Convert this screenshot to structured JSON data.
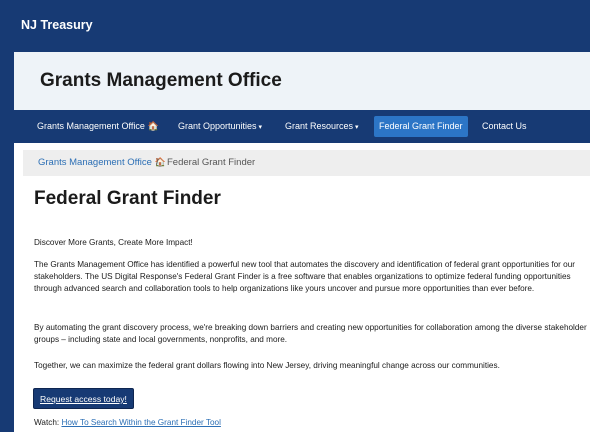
{
  "topbar": {
    "brand": "NJ Treasury"
  },
  "banner": {
    "title": "Grants Management Office"
  },
  "nav": {
    "items": [
      {
        "label": "Grants Management Office"
      },
      {
        "label": "Grant Opportunities",
        "caret": "▾"
      },
      {
        "label": "Grant Resources",
        "caret": "▾"
      },
      {
        "label": "Federal Grant Finder"
      },
      {
        "label": "Contact Us"
      }
    ],
    "home_glyph": "🏠",
    "active_color": "#2c75c6"
  },
  "breadcrumb": {
    "home": "Grants Management Office",
    "home_glyph": "🏠",
    "separator": "/",
    "current": "Federal Grant Finder"
  },
  "main": {
    "heading": "Federal Grant Finder",
    "p1": "Discover More Grants, Create More Impact!",
    "p2": "The Grants Management Office has identified a powerful new tool that automates the discovery and identification of federal grant opportunities for our stakeholders. The US Digital Response's Federal Grant Finder is a free software that enables organizations to optimize federal funding opportunities through advanced search and collaboration tools to help organizations like yours uncover and pursue more opportunities than ever before.",
    "p3": "By automating the grant discovery process, we're breaking down barriers and creating new opportunities for collaboration among the diverse stakeholder groups – including state and local governments, nonprofits, and more.",
    "p4": "Together, we can maximize the federal grant dollars flowing into New Jersey, driving meaningful change across our communities.",
    "cta": "Request access today!",
    "watch_label": "Watch:",
    "watch_link": "How To Search Within the Grant Finder Tool"
  },
  "colors": {
    "brand_navy": "#173a74",
    "link_blue": "#2c6fb5",
    "banner_bg": "#eef3f8"
  }
}
